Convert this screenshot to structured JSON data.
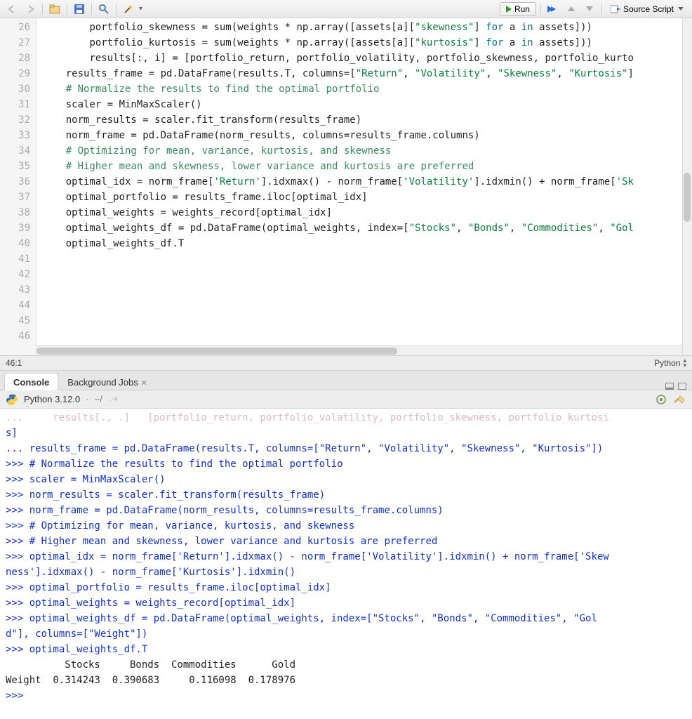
{
  "toolbar": {
    "run_label": "Run",
    "source_label": "Source Script"
  },
  "gutter_lines": [
    "26",
    "27",
    "28",
    "29",
    "30",
    "31",
    "32",
    "33",
    "34",
    "35",
    "36",
    "37",
    "38",
    "39",
    "40",
    "41",
    "42",
    "43",
    "44",
    "45",
    "46"
  ],
  "code_lines": [
    {
      "indent": "        ",
      "tokens": [
        {
          "t": "portfolio_skewness = sum(weights * np.array([assets[a]["
        },
        {
          "t": "\"skewness\"",
          "c": "c-str"
        },
        {
          "t": "] "
        },
        {
          "t": "for",
          "c": "c-kw"
        },
        {
          "t": " a "
        },
        {
          "t": "in",
          "c": "c-kw"
        },
        {
          "t": " assets]))"
        }
      ]
    },
    {
      "indent": "        ",
      "tokens": [
        {
          "t": "portfolio_kurtosis = sum(weights * np.array([assets[a]["
        },
        {
          "t": "\"kurtosis\"",
          "c": "c-str"
        },
        {
          "t": "] "
        },
        {
          "t": "for",
          "c": "c-kw"
        },
        {
          "t": " a "
        },
        {
          "t": "in",
          "c": "c-kw"
        },
        {
          "t": " assets]))"
        }
      ]
    },
    {
      "indent": "",
      "tokens": []
    },
    {
      "indent": "        ",
      "tokens": [
        {
          "t": "results[:, i] = [portfolio_return, portfolio_volatility, portfolio_skewness, portfolio_kurto"
        }
      ]
    },
    {
      "indent": "",
      "tokens": []
    },
    {
      "indent": "    ",
      "tokens": [
        {
          "t": "results_frame = pd.DataFrame(results.T, columns=["
        },
        {
          "t": "\"Return\"",
          "c": "c-str"
        },
        {
          "t": ", "
        },
        {
          "t": "\"Volatility\"",
          "c": "c-str"
        },
        {
          "t": ", "
        },
        {
          "t": "\"Skewness\"",
          "c": "c-str"
        },
        {
          "t": ", "
        },
        {
          "t": "\"Kurtosis\"",
          "c": "c-str"
        },
        {
          "t": "]"
        }
      ]
    },
    {
      "indent": "",
      "tokens": []
    },
    {
      "indent": "    ",
      "tokens": [
        {
          "t": "# Normalize the results to find the optimal portfolio",
          "c": "c-cmt"
        }
      ]
    },
    {
      "indent": "    ",
      "tokens": [
        {
          "t": "scaler = MinMaxScaler()"
        }
      ]
    },
    {
      "indent": "    ",
      "tokens": [
        {
          "t": "norm_results = scaler.fit_transform(results_frame)"
        }
      ]
    },
    {
      "indent": "    ",
      "tokens": [
        {
          "t": "norm_frame = pd.DataFrame(norm_results, columns=results_frame.columns)"
        }
      ]
    },
    {
      "indent": "",
      "tokens": []
    },
    {
      "indent": "    ",
      "tokens": [
        {
          "t": "# Optimizing for mean, variance, kurtosis, and skewness",
          "c": "c-cmt"
        }
      ]
    },
    {
      "indent": "    ",
      "tokens": [
        {
          "t": "# Higher mean and skewness, lower variance and kurtosis are preferred",
          "c": "c-cmt"
        }
      ]
    },
    {
      "indent": "    ",
      "tokens": [
        {
          "t": "optimal_idx = norm_frame["
        },
        {
          "t": "'Return'",
          "c": "c-str"
        },
        {
          "t": "].idxmax() - norm_frame["
        },
        {
          "t": "'Volatility'",
          "c": "c-str"
        },
        {
          "t": "].idxmin() + norm_frame["
        },
        {
          "t": "'Sk",
          "c": "c-str"
        }
      ]
    },
    {
      "indent": "",
      "tokens": []
    },
    {
      "indent": "    ",
      "tokens": [
        {
          "t": "optimal_portfolio = results_frame.iloc[optimal_idx]"
        }
      ]
    },
    {
      "indent": "    ",
      "tokens": [
        {
          "t": "optimal_weights = weights_record[optimal_idx]"
        }
      ]
    },
    {
      "indent": "    ",
      "tokens": [
        {
          "t": "optimal_weights_df = pd.DataFrame(optimal_weights, index=["
        },
        {
          "t": "\"Stocks\"",
          "c": "c-str"
        },
        {
          "t": ", "
        },
        {
          "t": "\"Bonds\"",
          "c": "c-str"
        },
        {
          "t": ", "
        },
        {
          "t": "\"Commodities\"",
          "c": "c-str"
        },
        {
          "t": ", "
        },
        {
          "t": "\"Gol",
          "c": "c-str"
        }
      ]
    },
    {
      "indent": "    ",
      "tokens": [
        {
          "t": "optimal_weights_df.T"
        }
      ]
    },
    {
      "indent": "",
      "tokens": []
    }
  ],
  "status": {
    "pos": "46:1",
    "lang": "Python"
  },
  "panel_tabs": {
    "console": "Console",
    "bgjobs": "Background Jobs"
  },
  "console_header": {
    "title": "Python 3.12.0",
    "path": "~/"
  },
  "console_lines": [
    {
      "c": "con-blur",
      "t": "...     results[., .]   [portfolio_return, portfolio_volatility, portfolio_skewness, portfolio_kurtosi"
    },
    {
      "c": "con-blue",
      "t": "s]"
    },
    {
      "c": "con-blue",
      "t": "... results_frame = pd.DataFrame(results.T, columns=[\"Return\", \"Volatility\", \"Skewness\", \"Kurtosis\"])"
    },
    {
      "c": "con-blue",
      "t": ">>> # Normalize the results to find the optimal portfolio"
    },
    {
      "c": "con-blue",
      "t": ">>> scaler = MinMaxScaler()"
    },
    {
      "c": "con-blue",
      "t": ">>> norm_results = scaler.fit_transform(results_frame)"
    },
    {
      "c": "con-blue",
      "t": ">>> norm_frame = pd.DataFrame(norm_results, columns=results_frame.columns)"
    },
    {
      "c": "con-blue",
      "t": ">>> # Optimizing for mean, variance, kurtosis, and skewness"
    },
    {
      "c": "con-blue",
      "t": ">>> # Higher mean and skewness, lower variance and kurtosis are preferred"
    },
    {
      "c": "con-blue",
      "t": ">>> optimal_idx = norm_frame['Return'].idxmax() - norm_frame['Volatility'].idxmin() + norm_frame['Skew"
    },
    {
      "c": "con-blue",
      "t": "ness'].idxmax() - norm_frame['Kurtosis'].idxmin()"
    },
    {
      "c": "con-blue",
      "t": ">>> optimal_portfolio = results_frame.iloc[optimal_idx]"
    },
    {
      "c": "con-blue",
      "t": ">>> optimal_weights = weights_record[optimal_idx]"
    },
    {
      "c": "con-blue",
      "t": ">>> optimal_weights_df = pd.DataFrame(optimal_weights, index=[\"Stocks\", \"Bonds\", \"Commodities\", \"Gol"
    },
    {
      "c": "con-blue",
      "t": "d\"], columns=[\"Weight\"])"
    },
    {
      "c": "con-blue",
      "t": ">>> optimal_weights_df.T"
    }
  ],
  "result_table": {
    "header": "          Stocks     Bonds  Commodities      Gold",
    "row": "Weight  0.314243  0.390683     0.116098  0.178976"
  },
  "prompt": ">>> "
}
